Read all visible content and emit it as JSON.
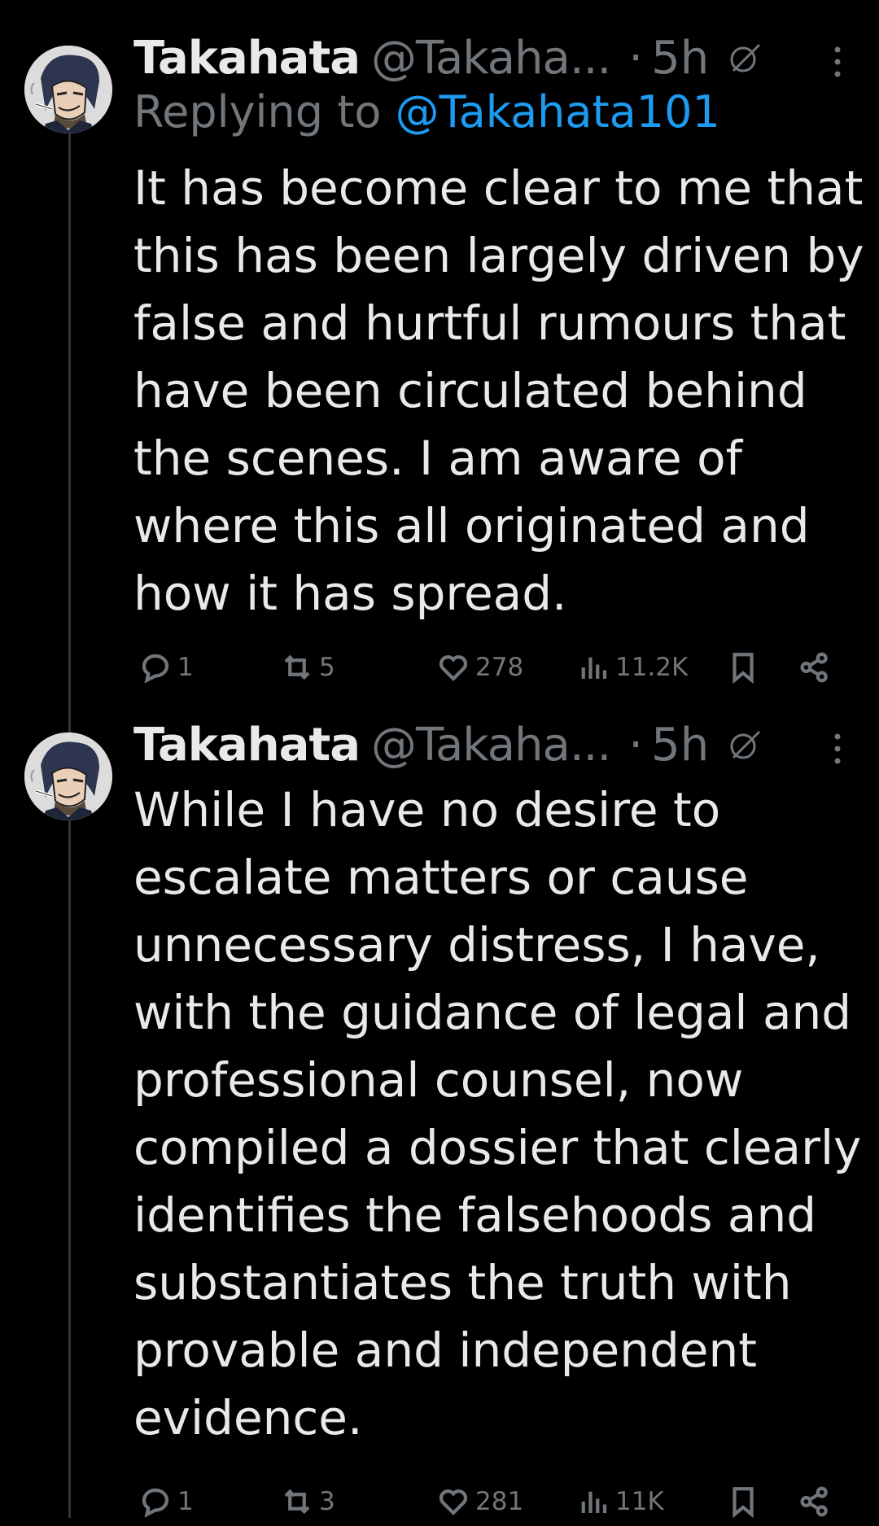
{
  "tweets": [
    {
      "name": "Takahata",
      "handle": "@Takaha...",
      "dot": "·",
      "time": "5h",
      "replying_prefix": "Replying to",
      "replying_mention": "@Takahata101",
      "text": "It has become clear to me that this has been largely driven by false and hurtful rumours that have been circulated behind the scenes. I am aware of where this all originated and how it has spread.",
      "replies": "1",
      "reposts": "5",
      "likes": "278",
      "views": "11.2K"
    },
    {
      "name": "Takahata",
      "handle": "@Takaha...",
      "dot": "·",
      "time": "5h",
      "text": "While I have no desire to escalate matters or cause unnecessary distress, I have, with the guidance of legal and professional counsel, now compiled a dossier that clearly identifies the falsehoods and substantiates the truth with provable and independent evidence.",
      "replies": "1",
      "reposts": "3",
      "likes": "281",
      "views": "11K"
    }
  ],
  "colors": {
    "background": "#000000",
    "text": "#e7e9ea",
    "muted": "#71767b",
    "link": "#1d9bf0",
    "thread_line": "#333639"
  },
  "icons": [
    "reply-icon",
    "repost-icon",
    "like-icon",
    "views-icon",
    "bookmark-icon",
    "share-icon",
    "more-icon",
    "grok-icon"
  ]
}
